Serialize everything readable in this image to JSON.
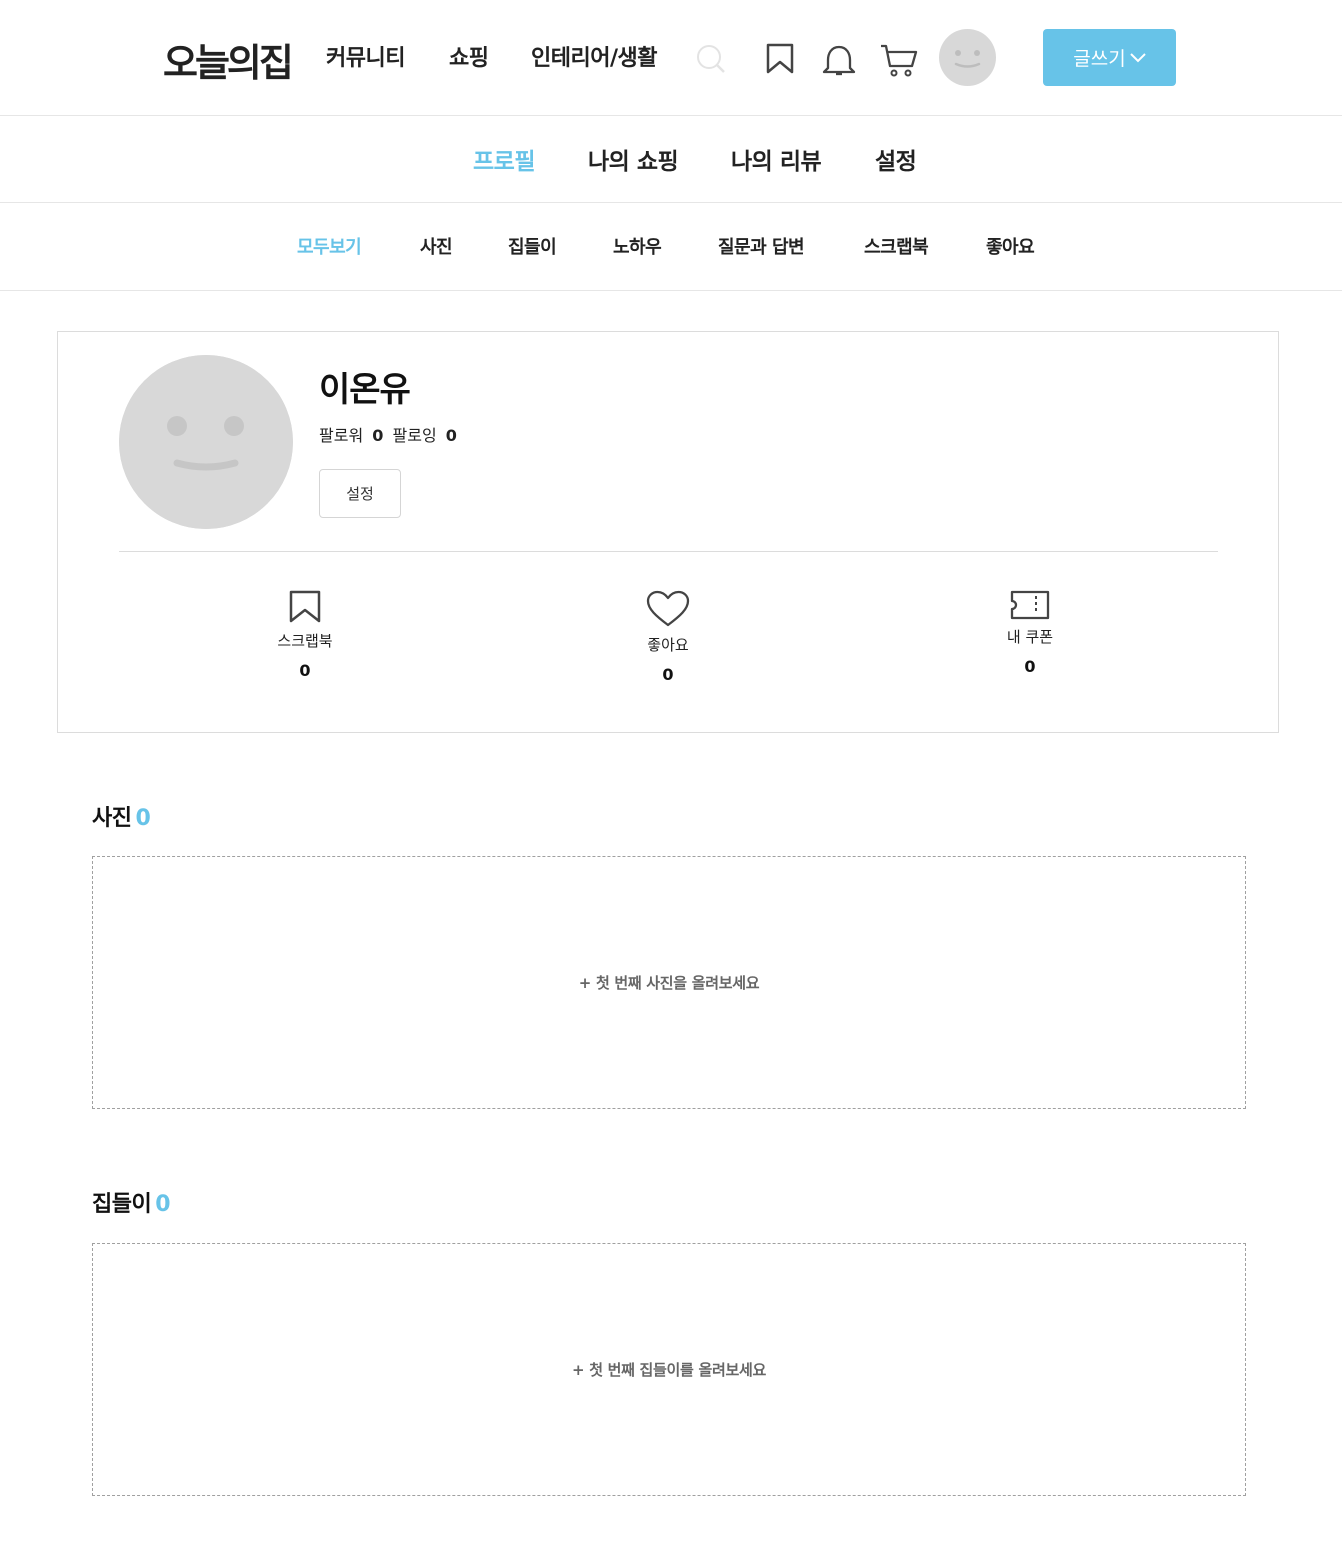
{
  "header": {
    "logo": "오늘의집",
    "nav": [
      "커뮤니티",
      "쇼핑",
      "인테리어/생활"
    ],
    "icons": [
      "search-icon",
      "bookmark-icon",
      "bell-icon",
      "cart-icon",
      "avatar"
    ],
    "write_label": "글쓰기"
  },
  "profile_tabs": [
    {
      "label": "프로필",
      "active": true
    },
    {
      "label": "나의 쇼핑",
      "active": false
    },
    {
      "label": "나의 리뷰",
      "active": false
    },
    {
      "label": "설정",
      "active": false
    }
  ],
  "sub_tabs": [
    {
      "label": "모두보기",
      "active": true
    },
    {
      "label": "사진",
      "active": false
    },
    {
      "label": "집들이",
      "active": false
    },
    {
      "label": "노하우",
      "active": false
    },
    {
      "label": "질문과 답변",
      "active": false
    },
    {
      "label": "스크랩북",
      "active": false
    },
    {
      "label": "좋아요",
      "active": false
    }
  ],
  "profile": {
    "name": "이온유",
    "follower_label": "팔로워",
    "follower_count": "0",
    "following_label": "팔로잉",
    "following_count": "0",
    "settings_label": "설정",
    "stats": [
      {
        "icon": "bookmark-icon",
        "label": "스크랩북",
        "count": "0"
      },
      {
        "icon": "heart-icon",
        "label": "좋아요",
        "count": "0"
      },
      {
        "icon": "coupon-icon",
        "label": "내 쿠폰",
        "count": "0"
      }
    ]
  },
  "sections": [
    {
      "title": "사진",
      "count": "0",
      "empty_cta": "+ 첫 번째 사진을 올려보세요"
    },
    {
      "title": "집들이",
      "count": "0",
      "empty_cta": "+ 첫 번째 집들이를 올려보세요"
    }
  ],
  "colors": {
    "accent": "#67c3e8",
    "border": "#dcdcdc",
    "avatar": "#d8d8d8"
  }
}
